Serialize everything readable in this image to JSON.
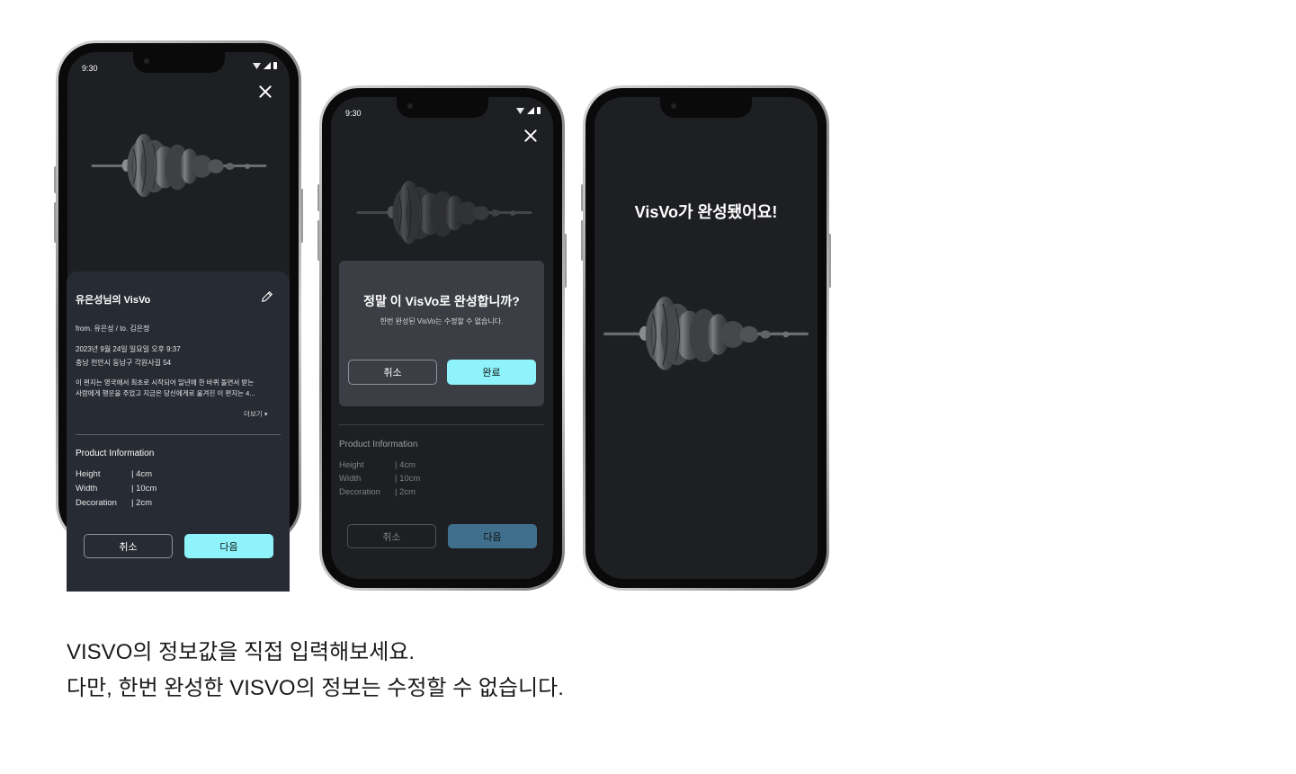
{
  "status_time": "9:30",
  "colors": {
    "screen_bg": "#1e1f22",
    "sheet_bg": "#272b33",
    "dialog_bg": "#3b3e44",
    "accent": "#8ef3fb",
    "accent_dimmed": "#3f6f8c",
    "visual_fill": "#5a5c60"
  },
  "icons": [
    "close-icon",
    "edit-pencil-icon",
    "wifi-icon",
    "signal-icon",
    "battery-icon",
    "dropdown-caret-icon"
  ],
  "screen1": {
    "card_title": "유은성님의 VisVo",
    "from_to": "from. 유은성 / to. 김은정",
    "datetime": "2023년 9월 24일 일요일 오후 9:37",
    "address": "충남 천안시 동남구 각원사길 54",
    "message_lines": [
      "이 편지는 영국에서 최초로 시작되어 일년에 한 바퀴 돌면서 받는",
      "사람에게 행운을 주었고 지금은 당신에게로 옮겨진 이 편지는 4..."
    ],
    "more_label": "더보기 ▾",
    "product_title": "Product Information",
    "specs": [
      {
        "label": "Height",
        "value": "| 4cm"
      },
      {
        "label": "Width",
        "value": "| 10cm"
      },
      {
        "label": "Decoration",
        "value": "| 2cm"
      }
    ],
    "cancel_label": "취소",
    "next_label": "다음"
  },
  "screen2": {
    "dialog_title": "정말 이 VisVo로 완성합니까?",
    "dialog_subtitle": "한번 완성된 VisVo는 수정할 수 없습니다.",
    "dialog_cancel": "취소",
    "dialog_confirm": "완료",
    "product_title": "Product Information",
    "specs": [
      {
        "label": "Height",
        "value": "| 4cm"
      },
      {
        "label": "Width",
        "value": "| 10cm"
      },
      {
        "label": "Decoration",
        "value": "| 2cm"
      }
    ],
    "cancel_label": "취소",
    "next_label": "다음"
  },
  "screen3": {
    "title": "VisVo가 완성됐어요!"
  },
  "caption": {
    "line1": "VISVO의 정보값을 직접 입력해보세요.",
    "line2": "다만, 한번 완성한 VISVO의 정보는 수정할 수 없습니다."
  }
}
